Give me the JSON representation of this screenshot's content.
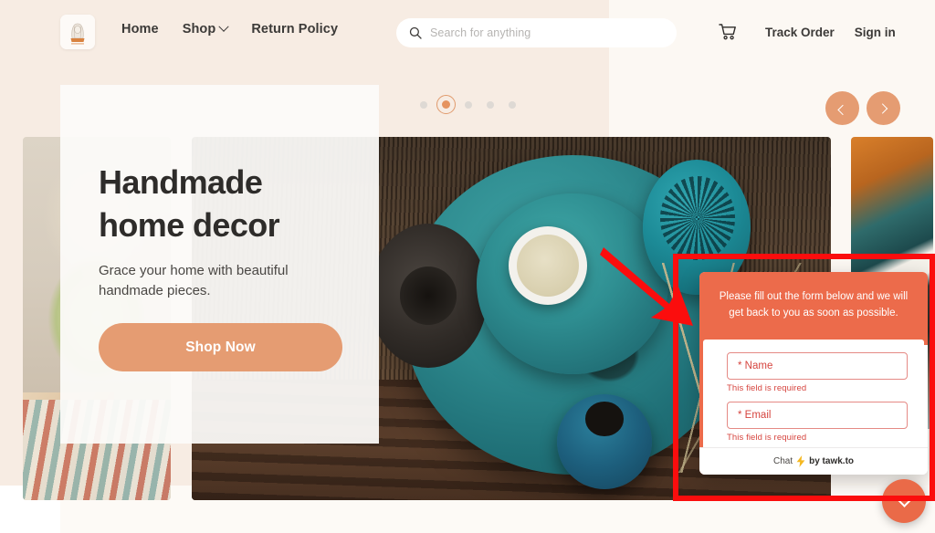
{
  "header": {
    "logo_alt": "handmade shop logo",
    "nav": [
      {
        "label": "Home",
        "has_dropdown": false
      },
      {
        "label": "Shop",
        "has_dropdown": true
      },
      {
        "label": "Return Policy",
        "has_dropdown": false
      }
    ],
    "search": {
      "placeholder": "Search for anything",
      "value": ""
    },
    "cart_label": "Cart",
    "links": [
      {
        "label": "Track Order"
      },
      {
        "label": "Sign in"
      }
    ]
  },
  "carousel": {
    "dots_total": 5,
    "active_index": 1,
    "prev_label": "Previous slide",
    "next_label": "Next slide"
  },
  "hero": {
    "title_line1": "Handmade",
    "title_line2": "home decor",
    "subtitle": "Grace your home with beautiful handmade pieces.",
    "cta_label": "Shop Now"
  },
  "chat": {
    "intro_message": "Please fill out the form below and we will get back to you as soon as possible.",
    "fields": [
      {
        "placeholder": "* Name",
        "value": "",
        "error": "This field is required"
      },
      {
        "placeholder": "* Email",
        "value": "",
        "error": "This field is required"
      }
    ],
    "footer_prefix": "Chat",
    "footer_brand": "by tawk.to",
    "toggle_label": "Minimize chat"
  },
  "colors": {
    "page_bg_left": "#f7ece3",
    "page_bg_right": "#fcf8f3",
    "accent_peach": "#e59c72",
    "chat_orange": "#ec6b4b",
    "chat_fab": "#ea6a48",
    "error_red": "#d6453f",
    "annotation_red": "#fb0d0d",
    "text_dark": "#2e2c2a"
  }
}
